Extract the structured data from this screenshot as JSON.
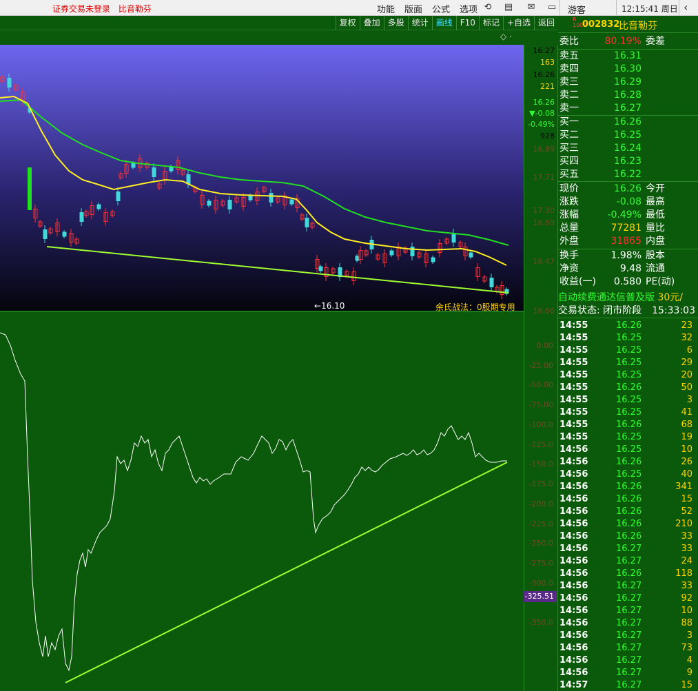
{
  "topbar": {
    "status": [
      "证券交易未登录",
      "比音勒芬"
    ],
    "menu": [
      "功能",
      "版面",
      "公式",
      "选项"
    ],
    "guest": "游客",
    "clock": "12:15:41 周日"
  },
  "toolbar": {
    "buttons": [
      "复权",
      "叠加",
      "多股",
      "统计",
      "画线",
      "F10",
      "标记",
      "+自选",
      "返回"
    ],
    "active": "画线"
  },
  "main_chart": {
    "strategy_label": "余氏战法：0股期专用",
    "low_label": "←16.10",
    "price_axis": [
      {
        "text": "16.27",
        "color": "#ffffff"
      },
      {
        "text": "163",
        "color": "#ffd400"
      },
      {
        "text": "16.26",
        "color": "#ffffff"
      },
      {
        "text": "221",
        "color": "#ffd400"
      },
      {
        "text": "16.26",
        "color": "#30ff30"
      },
      {
        "text": "▼-0.08",
        "color": "#30ff30"
      },
      {
        "text": "-0.49%",
        "color": "#30ff30"
      },
      {
        "text": "928",
        "color": "#ffffff"
      }
    ],
    "faint_axis": [
      "16.89",
      "17.71",
      "17.30",
      "16.89",
      "16.47",
      "16.06"
    ]
  },
  "indicator": {
    "axis": [
      "0.00",
      "-25.00",
      "-50.00",
      "-75.00",
      "-100.0",
      "-125.0",
      "-150.0",
      "-175.0",
      "-200.0",
      "-225.0",
      "-250.0",
      "-275.0",
      "-300.0",
      "-350.0"
    ],
    "current": "-325.51"
  },
  "quote": {
    "code": "002832",
    "name": "比音勒芬",
    "r_badge": "R\n1000",
    "weibi_label": "委比",
    "weibi_value": "80.19%",
    "weicha_label": "委差",
    "asks": [
      {
        "label": "卖五",
        "price": "16.31"
      },
      {
        "label": "卖四",
        "price": "16.30"
      },
      {
        "label": "卖三",
        "price": "16.29"
      },
      {
        "label": "卖二",
        "price": "16.28"
      },
      {
        "label": "卖一",
        "price": "16.27"
      }
    ],
    "bids": [
      {
        "label": "买一",
        "price": "16.26"
      },
      {
        "label": "买二",
        "price": "16.25"
      },
      {
        "label": "买三",
        "price": "16.24"
      },
      {
        "label": "买四",
        "price": "16.23"
      },
      {
        "label": "买五",
        "price": "16.22"
      }
    ],
    "stats": [
      {
        "label": "现价",
        "value": "16.26",
        "label2": "今开",
        "color": "green"
      },
      {
        "label": "涨跌",
        "value": "-0.08",
        "label2": "最高",
        "color": "green"
      },
      {
        "label": "涨幅",
        "value": "-0.49%",
        "label2": "最低",
        "color": "green"
      },
      {
        "label": "总量",
        "value": "77281",
        "label2": "量比",
        "color": "yellow"
      },
      {
        "label": "外盘",
        "value": "31865",
        "label2": "内盘",
        "color": "red"
      }
    ],
    "stats2": [
      {
        "label": "换手",
        "value": "1.98%",
        "label2": "股本"
      },
      {
        "label": "净资",
        "value": "9.48",
        "label2": "流通"
      },
      {
        "label": "收益(一)",
        "value": "0.580",
        "label2": "PE(动)"
      }
    ],
    "promo": "自动续费通达信普及版",
    "promo_price": "30元/",
    "trade_state": "交易状态: 闭市阶段",
    "trade_time": "15:33:03"
  },
  "ticks": [
    {
      "t": "14:55",
      "p": "16.26",
      "v": "23"
    },
    {
      "t": "14:55",
      "p": "16.25",
      "v": "32"
    },
    {
      "t": "14:55",
      "p": "16.25",
      "v": "6"
    },
    {
      "t": "14:55",
      "p": "16.25",
      "v": "29"
    },
    {
      "t": "14:55",
      "p": "16.25",
      "v": "20"
    },
    {
      "t": "14:55",
      "p": "16.26",
      "v": "50"
    },
    {
      "t": "14:55",
      "p": "16.25",
      "v": "3"
    },
    {
      "t": "14:55",
      "p": "16.25",
      "v": "41"
    },
    {
      "t": "14:55",
      "p": "16.26",
      "v": "68"
    },
    {
      "t": "14:55",
      "p": "16.25",
      "v": "19"
    },
    {
      "t": "14:56",
      "p": "16.25",
      "v": "10"
    },
    {
      "t": "14:56",
      "p": "16.26",
      "v": "26"
    },
    {
      "t": "14:56",
      "p": "16.25",
      "v": "40"
    },
    {
      "t": "14:56",
      "p": "16.26",
      "v": "341"
    },
    {
      "t": "14:56",
      "p": "16.26",
      "v": "15"
    },
    {
      "t": "14:56",
      "p": "16.26",
      "v": "52"
    },
    {
      "t": "14:56",
      "p": "16.26",
      "v": "210"
    },
    {
      "t": "14:56",
      "p": "16.26",
      "v": "33"
    },
    {
      "t": "14:56",
      "p": "16.27",
      "v": "33"
    },
    {
      "t": "14:56",
      "p": "16.27",
      "v": "24"
    },
    {
      "t": "14:56",
      "p": "16.26",
      "v": "118"
    },
    {
      "t": "14:56",
      "p": "16.27",
      "v": "33"
    },
    {
      "t": "14:56",
      "p": "16.27",
      "v": "92"
    },
    {
      "t": "14:56",
      "p": "16.27",
      "v": "10"
    },
    {
      "t": "14:56",
      "p": "16.27",
      "v": "88"
    },
    {
      "t": "14:56",
      "p": "16.27",
      "v": "3"
    },
    {
      "t": "14:56",
      "p": "16.27",
      "v": "73"
    },
    {
      "t": "14:56",
      "p": "16.27",
      "v": "4"
    },
    {
      "t": "14:56",
      "p": "16.27",
      "v": "9"
    },
    {
      "t": "14:57",
      "p": "16.27",
      "v": "15"
    }
  ],
  "colors": {
    "up": "#ff3030",
    "down": "#30ff30",
    "accent": "#ffd400",
    "bg": "#0b5a0b"
  }
}
